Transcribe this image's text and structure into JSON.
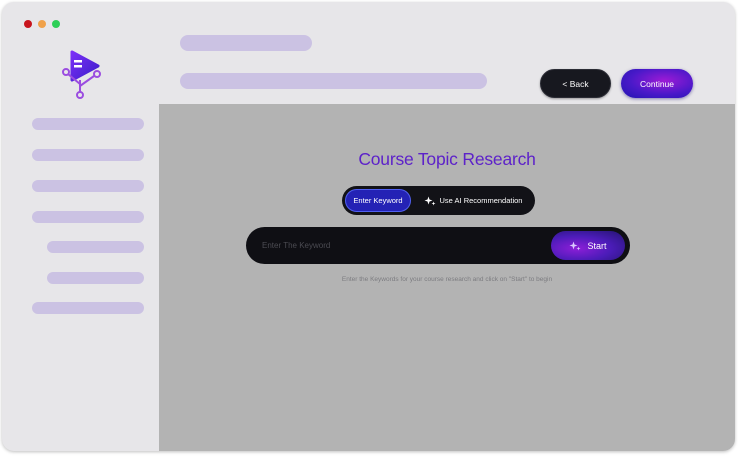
{
  "window": {
    "controls": [
      "close",
      "minimize",
      "maximize"
    ]
  },
  "header": {
    "back_label": "< Back",
    "continue_label": "Continue"
  },
  "main": {
    "title": "Course Topic Research",
    "toggle": {
      "options": [
        {
          "label": "Enter Keyword",
          "active": true
        },
        {
          "label": "Use AI Recommendation",
          "icon": "sparkle-icon",
          "active": false
        }
      ]
    },
    "search": {
      "placeholder": "Enter The Keyword",
      "value": "",
      "start_label": "Start",
      "start_icon": "sparkle-icon"
    },
    "hint": "Enter the Keywords for your course research and click on \"Start\" to begin"
  },
  "colors": {
    "accent_purple": "#5d22c9",
    "skeleton": "#cbc2e3",
    "dark_button": "#17181f",
    "toggle_active": "#2422b5"
  }
}
